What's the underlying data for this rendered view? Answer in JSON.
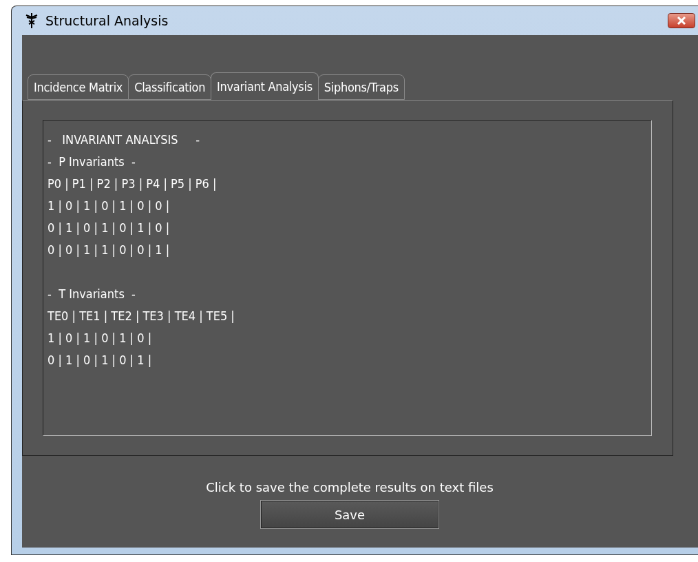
{
  "window": {
    "title": "Structural Analysis"
  },
  "tabs": [
    {
      "label": "Incidence Matrix",
      "selected": false
    },
    {
      "label": "Classification",
      "selected": false
    },
    {
      "label": "Invariant Analysis",
      "selected": true
    },
    {
      "label": "Siphons/Traps",
      "selected": false
    }
  ],
  "output": {
    "blocks": [
      [
        "-   INVARIANT ANALYSIS     -",
        "-  P Invariants  -",
        "P0 | P1 | P2 | P3 | P4 | P5 | P6 |",
        "1 | 0 | 1 | 0 | 1 | 0 | 0 |",
        "0 | 1 | 0 | 1 | 0 | 1 | 0 |",
        "0 | 0 | 1 | 1 | 0 | 0 | 1 |"
      ],
      [
        "-  T Invariants  -",
        "TE0 | TE1 | TE2 | TE3 | TE4 | TE5 |",
        "1 | 0 | 1 | 0 | 1 | 0 |",
        "0 | 1 | 0 | 1 | 0 | 1 |"
      ]
    ]
  },
  "footer": {
    "hint": "Click to save the complete results on text files",
    "button": "Save"
  }
}
